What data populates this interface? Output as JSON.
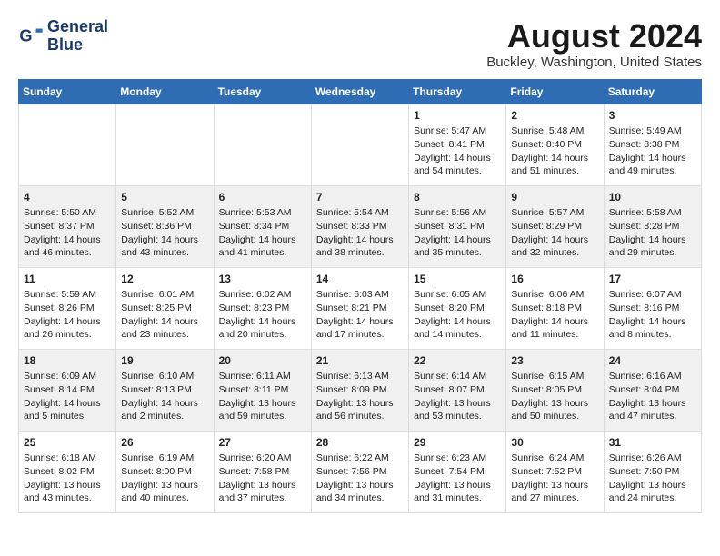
{
  "logo": {
    "line1": "General",
    "line2": "Blue"
  },
  "title": "August 2024",
  "subtitle": "Buckley, Washington, United States",
  "days_of_week": [
    "Sunday",
    "Monday",
    "Tuesday",
    "Wednesday",
    "Thursday",
    "Friday",
    "Saturday"
  ],
  "weeks": [
    [
      {
        "day": "",
        "content": ""
      },
      {
        "day": "",
        "content": ""
      },
      {
        "day": "",
        "content": ""
      },
      {
        "day": "",
        "content": ""
      },
      {
        "day": "1",
        "content": "Sunrise: 5:47 AM\nSunset: 8:41 PM\nDaylight: 14 hours\nand 54 minutes."
      },
      {
        "day": "2",
        "content": "Sunrise: 5:48 AM\nSunset: 8:40 PM\nDaylight: 14 hours\nand 51 minutes."
      },
      {
        "day": "3",
        "content": "Sunrise: 5:49 AM\nSunset: 8:38 PM\nDaylight: 14 hours\nand 49 minutes."
      }
    ],
    [
      {
        "day": "4",
        "content": "Sunrise: 5:50 AM\nSunset: 8:37 PM\nDaylight: 14 hours\nand 46 minutes."
      },
      {
        "day": "5",
        "content": "Sunrise: 5:52 AM\nSunset: 8:36 PM\nDaylight: 14 hours\nand 43 minutes."
      },
      {
        "day": "6",
        "content": "Sunrise: 5:53 AM\nSunset: 8:34 PM\nDaylight: 14 hours\nand 41 minutes."
      },
      {
        "day": "7",
        "content": "Sunrise: 5:54 AM\nSunset: 8:33 PM\nDaylight: 14 hours\nand 38 minutes."
      },
      {
        "day": "8",
        "content": "Sunrise: 5:56 AM\nSunset: 8:31 PM\nDaylight: 14 hours\nand 35 minutes."
      },
      {
        "day": "9",
        "content": "Sunrise: 5:57 AM\nSunset: 8:29 PM\nDaylight: 14 hours\nand 32 minutes."
      },
      {
        "day": "10",
        "content": "Sunrise: 5:58 AM\nSunset: 8:28 PM\nDaylight: 14 hours\nand 29 minutes."
      }
    ],
    [
      {
        "day": "11",
        "content": "Sunrise: 5:59 AM\nSunset: 8:26 PM\nDaylight: 14 hours\nand 26 minutes."
      },
      {
        "day": "12",
        "content": "Sunrise: 6:01 AM\nSunset: 8:25 PM\nDaylight: 14 hours\nand 23 minutes."
      },
      {
        "day": "13",
        "content": "Sunrise: 6:02 AM\nSunset: 8:23 PM\nDaylight: 14 hours\nand 20 minutes."
      },
      {
        "day": "14",
        "content": "Sunrise: 6:03 AM\nSunset: 8:21 PM\nDaylight: 14 hours\nand 17 minutes."
      },
      {
        "day": "15",
        "content": "Sunrise: 6:05 AM\nSunset: 8:20 PM\nDaylight: 14 hours\nand 14 minutes."
      },
      {
        "day": "16",
        "content": "Sunrise: 6:06 AM\nSunset: 8:18 PM\nDaylight: 14 hours\nand 11 minutes."
      },
      {
        "day": "17",
        "content": "Sunrise: 6:07 AM\nSunset: 8:16 PM\nDaylight: 14 hours\nand 8 minutes."
      }
    ],
    [
      {
        "day": "18",
        "content": "Sunrise: 6:09 AM\nSunset: 8:14 PM\nDaylight: 14 hours\nand 5 minutes."
      },
      {
        "day": "19",
        "content": "Sunrise: 6:10 AM\nSunset: 8:13 PM\nDaylight: 14 hours\nand 2 minutes."
      },
      {
        "day": "20",
        "content": "Sunrise: 6:11 AM\nSunset: 8:11 PM\nDaylight: 13 hours\nand 59 minutes."
      },
      {
        "day": "21",
        "content": "Sunrise: 6:13 AM\nSunset: 8:09 PM\nDaylight: 13 hours\nand 56 minutes."
      },
      {
        "day": "22",
        "content": "Sunrise: 6:14 AM\nSunset: 8:07 PM\nDaylight: 13 hours\nand 53 minutes."
      },
      {
        "day": "23",
        "content": "Sunrise: 6:15 AM\nSunset: 8:05 PM\nDaylight: 13 hours\nand 50 minutes."
      },
      {
        "day": "24",
        "content": "Sunrise: 6:16 AM\nSunset: 8:04 PM\nDaylight: 13 hours\nand 47 minutes."
      }
    ],
    [
      {
        "day": "25",
        "content": "Sunrise: 6:18 AM\nSunset: 8:02 PM\nDaylight: 13 hours\nand 43 minutes."
      },
      {
        "day": "26",
        "content": "Sunrise: 6:19 AM\nSunset: 8:00 PM\nDaylight: 13 hours\nand 40 minutes."
      },
      {
        "day": "27",
        "content": "Sunrise: 6:20 AM\nSunset: 7:58 PM\nDaylight: 13 hours\nand 37 minutes."
      },
      {
        "day": "28",
        "content": "Sunrise: 6:22 AM\nSunset: 7:56 PM\nDaylight: 13 hours\nand 34 minutes."
      },
      {
        "day": "29",
        "content": "Sunrise: 6:23 AM\nSunset: 7:54 PM\nDaylight: 13 hours\nand 31 minutes."
      },
      {
        "day": "30",
        "content": "Sunrise: 6:24 AM\nSunset: 7:52 PM\nDaylight: 13 hours\nand 27 minutes."
      },
      {
        "day": "31",
        "content": "Sunrise: 6:26 AM\nSunset: 7:50 PM\nDaylight: 13 hours\nand 24 minutes."
      }
    ]
  ]
}
